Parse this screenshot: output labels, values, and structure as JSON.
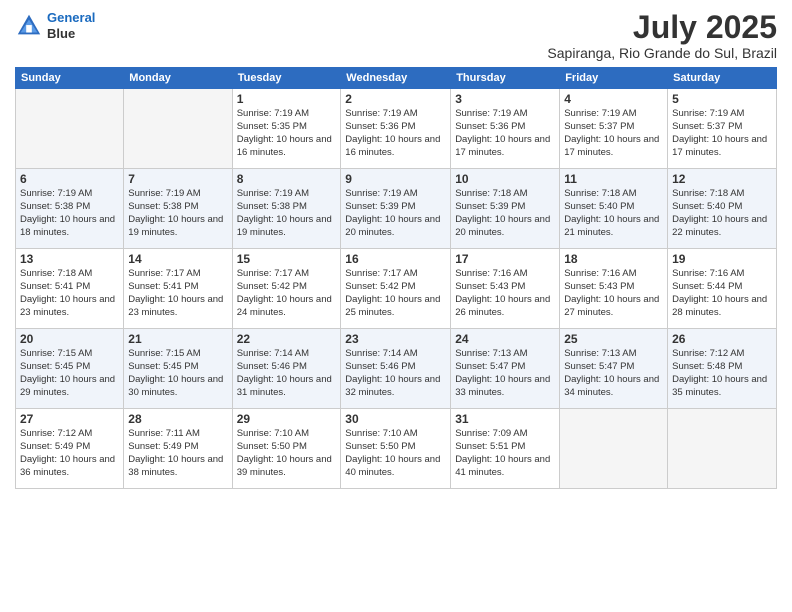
{
  "logo": {
    "line1": "General",
    "line2": "Blue"
  },
  "title": "July 2025",
  "subtitle": "Sapiranga, Rio Grande do Sul, Brazil",
  "weekdays": [
    "Sunday",
    "Monday",
    "Tuesday",
    "Wednesday",
    "Thursday",
    "Friday",
    "Saturday"
  ],
  "weeks": [
    [
      {
        "day": "",
        "info": ""
      },
      {
        "day": "",
        "info": ""
      },
      {
        "day": "1",
        "info": "Sunrise: 7:19 AM\nSunset: 5:35 PM\nDaylight: 10 hours and 16 minutes."
      },
      {
        "day": "2",
        "info": "Sunrise: 7:19 AM\nSunset: 5:36 PM\nDaylight: 10 hours and 16 minutes."
      },
      {
        "day": "3",
        "info": "Sunrise: 7:19 AM\nSunset: 5:36 PM\nDaylight: 10 hours and 17 minutes."
      },
      {
        "day": "4",
        "info": "Sunrise: 7:19 AM\nSunset: 5:37 PM\nDaylight: 10 hours and 17 minutes."
      },
      {
        "day": "5",
        "info": "Sunrise: 7:19 AM\nSunset: 5:37 PM\nDaylight: 10 hours and 17 minutes."
      }
    ],
    [
      {
        "day": "6",
        "info": "Sunrise: 7:19 AM\nSunset: 5:38 PM\nDaylight: 10 hours and 18 minutes."
      },
      {
        "day": "7",
        "info": "Sunrise: 7:19 AM\nSunset: 5:38 PM\nDaylight: 10 hours and 19 minutes."
      },
      {
        "day": "8",
        "info": "Sunrise: 7:19 AM\nSunset: 5:38 PM\nDaylight: 10 hours and 19 minutes."
      },
      {
        "day": "9",
        "info": "Sunrise: 7:19 AM\nSunset: 5:39 PM\nDaylight: 10 hours and 20 minutes."
      },
      {
        "day": "10",
        "info": "Sunrise: 7:18 AM\nSunset: 5:39 PM\nDaylight: 10 hours and 20 minutes."
      },
      {
        "day": "11",
        "info": "Sunrise: 7:18 AM\nSunset: 5:40 PM\nDaylight: 10 hours and 21 minutes."
      },
      {
        "day": "12",
        "info": "Sunrise: 7:18 AM\nSunset: 5:40 PM\nDaylight: 10 hours and 22 minutes."
      }
    ],
    [
      {
        "day": "13",
        "info": "Sunrise: 7:18 AM\nSunset: 5:41 PM\nDaylight: 10 hours and 23 minutes."
      },
      {
        "day": "14",
        "info": "Sunrise: 7:17 AM\nSunset: 5:41 PM\nDaylight: 10 hours and 23 minutes."
      },
      {
        "day": "15",
        "info": "Sunrise: 7:17 AM\nSunset: 5:42 PM\nDaylight: 10 hours and 24 minutes."
      },
      {
        "day": "16",
        "info": "Sunrise: 7:17 AM\nSunset: 5:42 PM\nDaylight: 10 hours and 25 minutes."
      },
      {
        "day": "17",
        "info": "Sunrise: 7:16 AM\nSunset: 5:43 PM\nDaylight: 10 hours and 26 minutes."
      },
      {
        "day": "18",
        "info": "Sunrise: 7:16 AM\nSunset: 5:43 PM\nDaylight: 10 hours and 27 minutes."
      },
      {
        "day": "19",
        "info": "Sunrise: 7:16 AM\nSunset: 5:44 PM\nDaylight: 10 hours and 28 minutes."
      }
    ],
    [
      {
        "day": "20",
        "info": "Sunrise: 7:15 AM\nSunset: 5:45 PM\nDaylight: 10 hours and 29 minutes."
      },
      {
        "day": "21",
        "info": "Sunrise: 7:15 AM\nSunset: 5:45 PM\nDaylight: 10 hours and 30 minutes."
      },
      {
        "day": "22",
        "info": "Sunrise: 7:14 AM\nSunset: 5:46 PM\nDaylight: 10 hours and 31 minutes."
      },
      {
        "day": "23",
        "info": "Sunrise: 7:14 AM\nSunset: 5:46 PM\nDaylight: 10 hours and 32 minutes."
      },
      {
        "day": "24",
        "info": "Sunrise: 7:13 AM\nSunset: 5:47 PM\nDaylight: 10 hours and 33 minutes."
      },
      {
        "day": "25",
        "info": "Sunrise: 7:13 AM\nSunset: 5:47 PM\nDaylight: 10 hours and 34 minutes."
      },
      {
        "day": "26",
        "info": "Sunrise: 7:12 AM\nSunset: 5:48 PM\nDaylight: 10 hours and 35 minutes."
      }
    ],
    [
      {
        "day": "27",
        "info": "Sunrise: 7:12 AM\nSunset: 5:49 PM\nDaylight: 10 hours and 36 minutes."
      },
      {
        "day": "28",
        "info": "Sunrise: 7:11 AM\nSunset: 5:49 PM\nDaylight: 10 hours and 38 minutes."
      },
      {
        "day": "29",
        "info": "Sunrise: 7:10 AM\nSunset: 5:50 PM\nDaylight: 10 hours and 39 minutes."
      },
      {
        "day": "30",
        "info": "Sunrise: 7:10 AM\nSunset: 5:50 PM\nDaylight: 10 hours and 40 minutes."
      },
      {
        "day": "31",
        "info": "Sunrise: 7:09 AM\nSunset: 5:51 PM\nDaylight: 10 hours and 41 minutes."
      },
      {
        "day": "",
        "info": ""
      },
      {
        "day": "",
        "info": ""
      }
    ]
  ]
}
